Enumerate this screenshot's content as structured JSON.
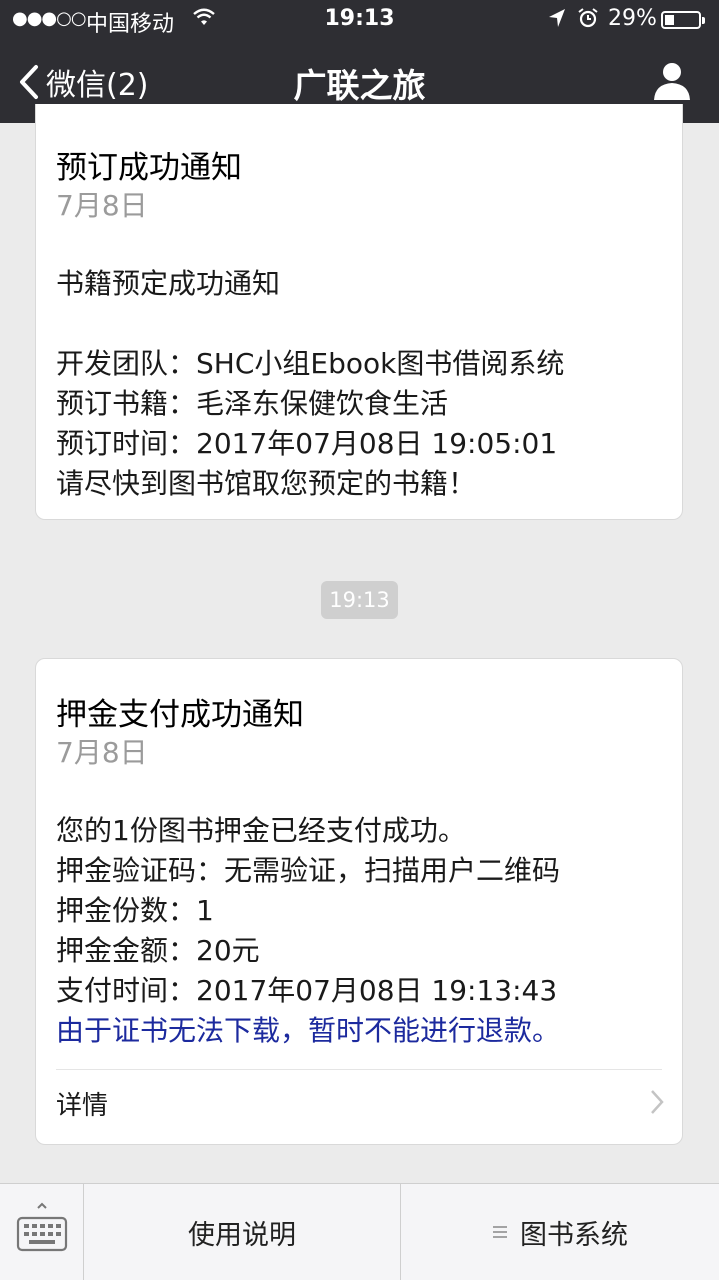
{
  "status_bar": {
    "signal": "●●●○○",
    "carrier": "中国移动",
    "time": "19:13",
    "battery_percent": "29%",
    "battery_level": 0.29
  },
  "nav": {
    "back_label": "微信(2)",
    "title": "广联之旅"
  },
  "messages": [
    {
      "title": "预订成功通知",
      "date": "7月8日",
      "lines": [
        "书籍预定成功通知",
        "开发团队：SHC小组Ebook图书借阅系统",
        "预订书籍：毛泽东保健饮食生活",
        "预订时间：2017年07月08日 19:05:01",
        "请尽快到图书馆取您预定的书籍！"
      ]
    },
    {
      "title": "押金支付成功通知",
      "date": "7月8日",
      "lines": [
        "您的1份图书押金已经支付成功。",
        "押金验证码：无需验证，扫描用户二维码",
        "押金份数：1",
        "押金金额：20元",
        "支付时间：2017年07月08日 19:13:43",
        "由于证书无法下载，暂时不能进行退款。"
      ],
      "detail_label": "详情"
    }
  ],
  "timestamp": "19:13",
  "bottom_menu": {
    "item1": "使用说明",
    "item2": "图书系统"
  },
  "colors": {
    "nav_bg": "#2e2e33",
    "remark_blue": "#1c2a9e",
    "page_bg": "#ebebeb"
  }
}
